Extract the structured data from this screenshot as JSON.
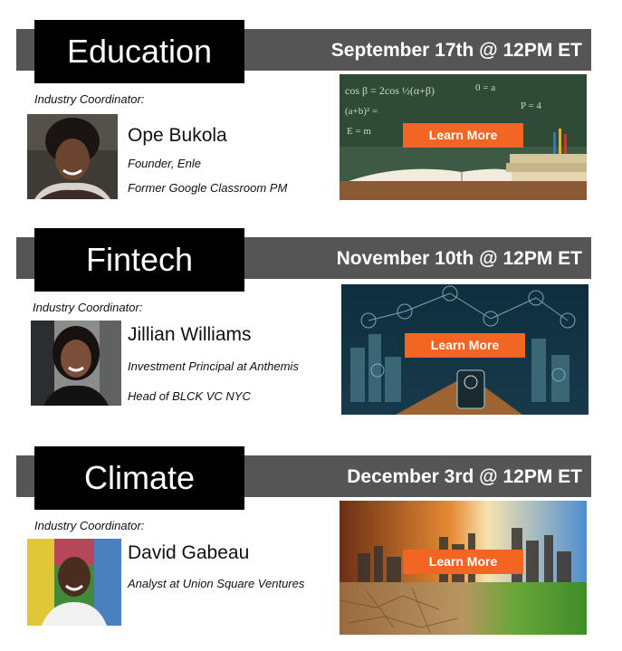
{
  "sections": [
    {
      "title": "Education",
      "date": "September 17th @ 12PM ET",
      "coordinator_label": "Industry Coordinator:",
      "person_name": "Ope Bukola",
      "roles": [
        "Founder, Enle",
        "Former Google Classroom PM"
      ],
      "cta": "Learn More",
      "image": "education-books-chalkboard-image",
      "photo": "ope-bukola-portrait"
    },
    {
      "title": "Fintech",
      "date": "November 10th @ 12PM ET",
      "coordinator_label": "Industry Coordinator:",
      "person_name": "Jillian Williams",
      "roles": [
        "Investment Principal at Anthemis",
        "Head of BLCK VC NYC"
      ],
      "cta": "Learn More",
      "image": "fintech-city-network-image",
      "photo": "jillian-williams-portrait"
    },
    {
      "title": "Climate",
      "date": "December 3rd @ 12PM ET",
      "coordinator_label": "Industry Coordinator:",
      "person_name": "David Gabeau",
      "roles": [
        "Analyst at Union Square Ventures"
      ],
      "cta": "Learn More",
      "image": "climate-city-drought-image",
      "photo": "david-gabeau-portrait"
    }
  ],
  "colors": {
    "title_box": "#000000",
    "date_bar": "#555555",
    "button": "#f26522",
    "text": "#111111"
  }
}
